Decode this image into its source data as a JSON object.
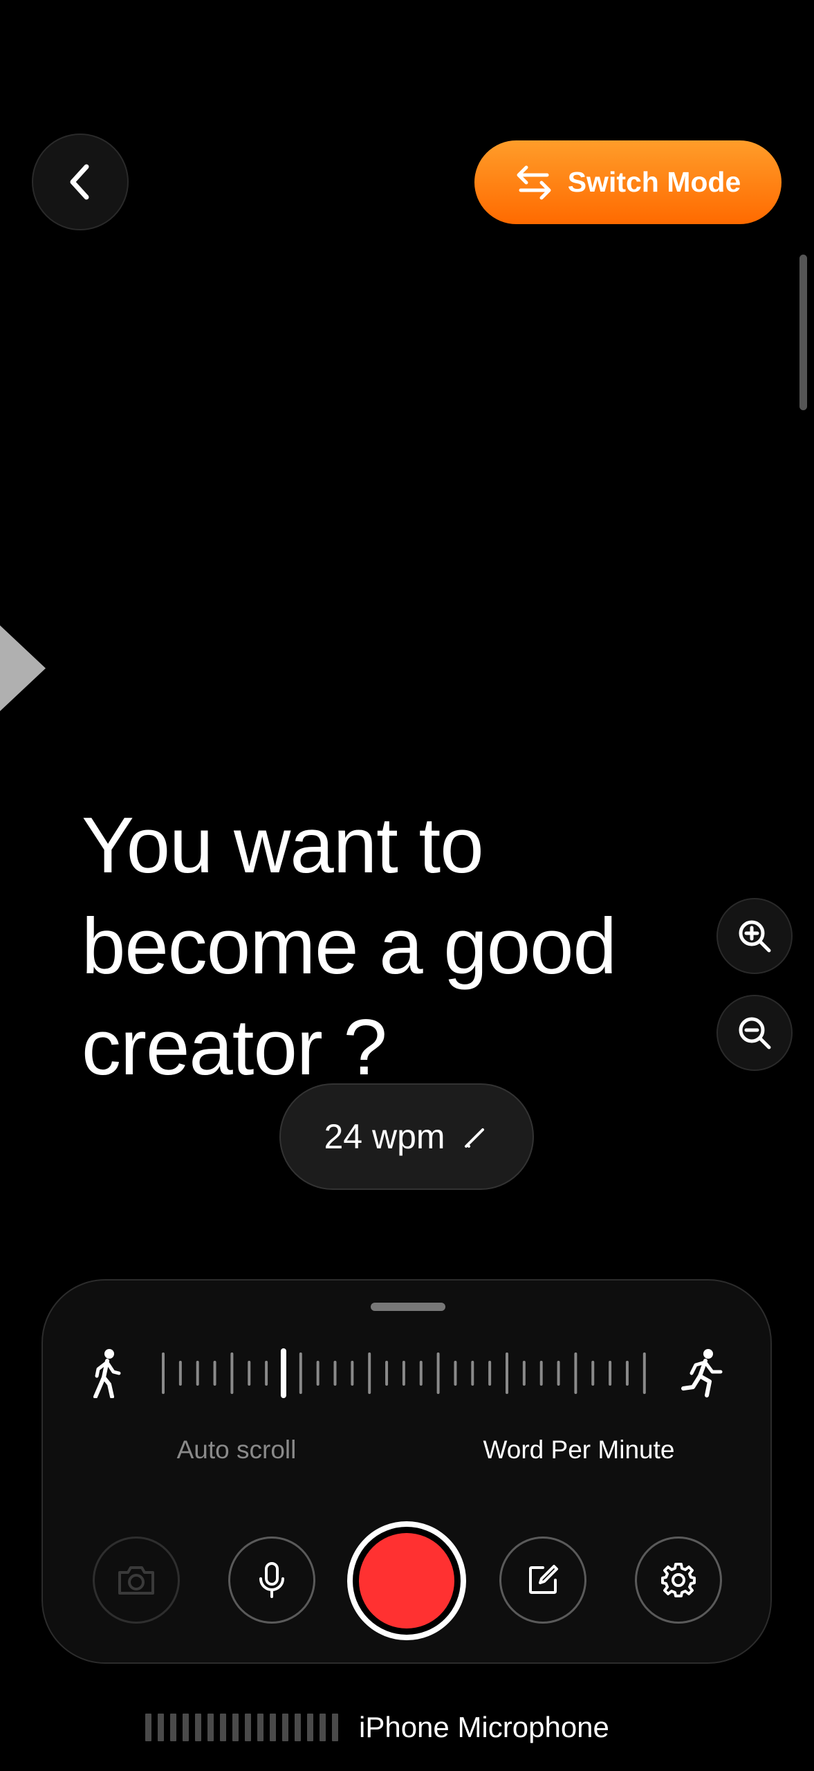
{
  "header": {
    "back_icon": "chevron-left-icon",
    "switch_mode_label": "Switch Mode",
    "switch_mode_icon": "swap-arrows-icon",
    "accent_color": "#ff7a10"
  },
  "script": {
    "text": "You want to become a good creator ?"
  },
  "zoom": {
    "in_icon": "zoom-in-icon",
    "out_icon": "zoom-out-icon"
  },
  "speed": {
    "value_label": "24 wpm",
    "edit_icon": "pencil-icon"
  },
  "panel": {
    "slow_icon": "walking-icon",
    "fast_icon": "running-icon",
    "modes": {
      "auto_scroll": "Auto scroll",
      "word_per_minute": "Word Per Minute"
    },
    "active_mode": "Word Per Minute",
    "controls": {
      "camera_icon": "camera-icon",
      "microphone_icon": "microphone-icon",
      "record_icon": "record-icon",
      "edit_icon": "edit-square-icon",
      "settings_icon": "gear-icon"
    },
    "record_color": "#ff3131"
  },
  "footer": {
    "input_device": "iPhone Microphone",
    "level_meter_icon": "audio-level-meter"
  }
}
